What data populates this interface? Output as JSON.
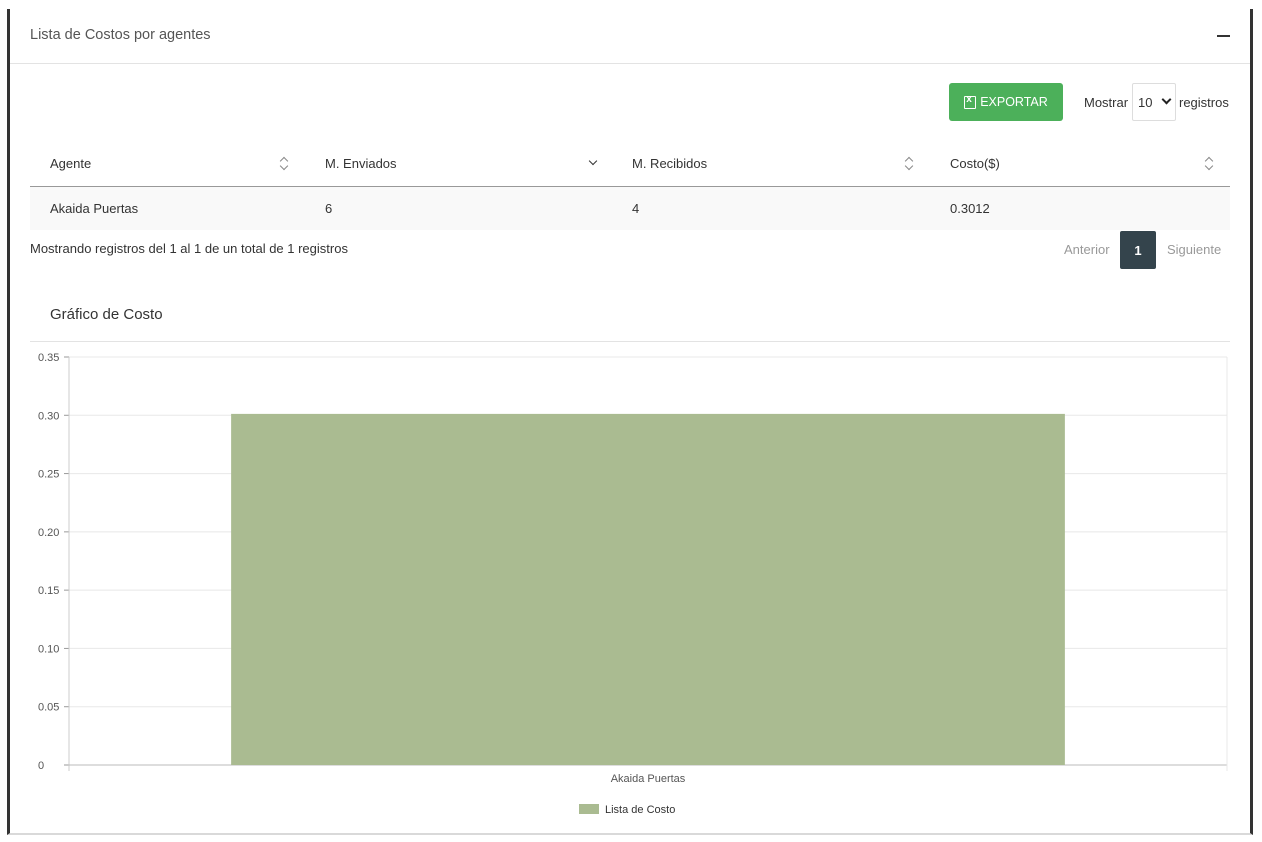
{
  "card": {
    "title": "Lista de Costos por agentes"
  },
  "toolbar": {
    "export_label": "EXPORTAR",
    "show_label": "Mostrar",
    "page_length": "10",
    "records_label": "registros"
  },
  "table": {
    "columns": [
      "Agente",
      "M. Enviados",
      "M. Recibidos",
      "Costo($)"
    ],
    "rows": [
      [
        "Akaida Puertas",
        "6",
        "4",
        "0.3012"
      ]
    ]
  },
  "footer": {
    "info": "Mostrando registros del 1 al 1 de un total de 1 registros",
    "prev": "Anterior",
    "current_page": "1",
    "next": "Siguiente"
  },
  "chart_section": {
    "title": "Gráfico de Costo"
  },
  "colors": {
    "export_button": "#4cb05a",
    "bar": "#aabb91",
    "page_active": "#34444c"
  },
  "chart_data": {
    "type": "bar",
    "categories": [
      "Akaida Puertas"
    ],
    "series": [
      {
        "name": "Lista de Costo",
        "values": [
          0.3012
        ]
      }
    ],
    "ylim": [
      0,
      0.35
    ],
    "yticks": [
      "0",
      "0.05",
      "0.10",
      "0.15",
      "0.20",
      "0.25",
      "0.30",
      "0.35"
    ],
    "grid": true,
    "legend": "bottom"
  }
}
